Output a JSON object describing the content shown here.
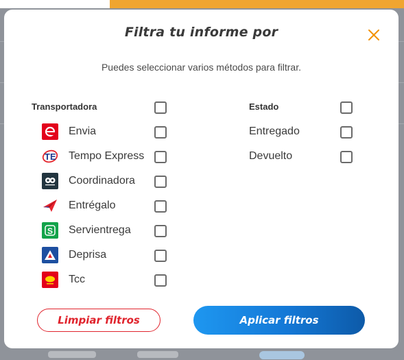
{
  "modal": {
    "title": "Filtra tu informe por",
    "subtitle": "Puedes seleccionar varios métodos para filtrar.",
    "close_icon": "close-icon",
    "accent_color": "#f39200"
  },
  "carriers": {
    "heading": "Transportadora",
    "items": [
      {
        "label": "Envia",
        "icon": "envia-logo",
        "checked": false
      },
      {
        "label": "Tempo Express",
        "icon": "tempo-express-logo",
        "checked": false
      },
      {
        "label": "Coordinadora",
        "icon": "coordinadora-logo",
        "checked": false
      },
      {
        "label": "Entrégalo",
        "icon": "entregalo-logo",
        "checked": false
      },
      {
        "label": "Servientrega",
        "icon": "servientrega-logo",
        "checked": false
      },
      {
        "label": "Deprisa",
        "icon": "deprisa-logo",
        "checked": false
      },
      {
        "label": "Tcc",
        "icon": "tcc-logo",
        "checked": false
      }
    ]
  },
  "status": {
    "heading": "Estado",
    "items": [
      {
        "label": "Entregado",
        "checked": false
      },
      {
        "label": "Devuelto",
        "checked": false
      }
    ]
  },
  "buttons": {
    "clear_label": "Limpiar filtros",
    "apply_label": "Aplicar filtros"
  },
  "colors": {
    "clear_button": "#e0242d",
    "apply_button_start": "#1e97f0",
    "apply_button_end": "#0d5aa8"
  }
}
